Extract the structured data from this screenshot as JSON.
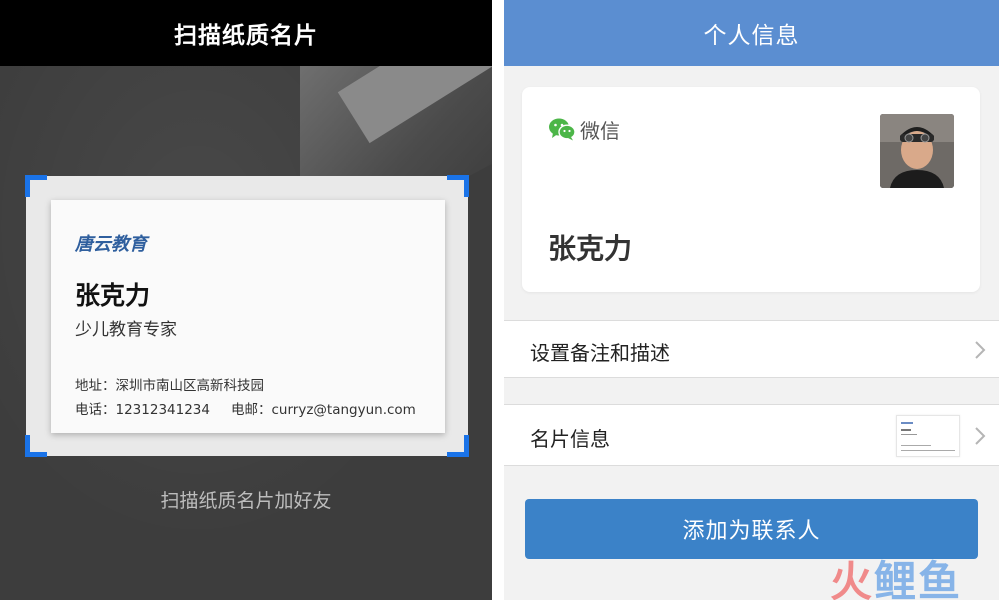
{
  "scanner": {
    "title": "扫描纸质名片",
    "hint": "扫描纸质名片加好友",
    "card": {
      "company": "唐云教育",
      "name": "张克力",
      "position": "少儿教育专家",
      "address": "地址：深圳市南山区高新科技园",
      "phone": "电话：12312341234",
      "email": "电邮：curryz@tangyun.com"
    }
  },
  "profile": {
    "title": "个人信息",
    "source_label": "微信",
    "name": "张克力",
    "rows": [
      {
        "label": "设置备注和描述"
      },
      {
        "label": "名片信息"
      }
    ],
    "add_button": "添加为联系人",
    "watermark": [
      "火",
      "鲤",
      "鱼"
    ]
  },
  "colors": {
    "scan_accent": "#1a73e8",
    "header_blue": "#5b8ed1",
    "button_blue": "#3b82c8",
    "wechat_green": "#4cb648",
    "company_blue": "#2f5f9e"
  },
  "icons": [
    "wechat-icon",
    "chevron-right-icon",
    "avatar-photo",
    "business-card-thumbnail"
  ]
}
